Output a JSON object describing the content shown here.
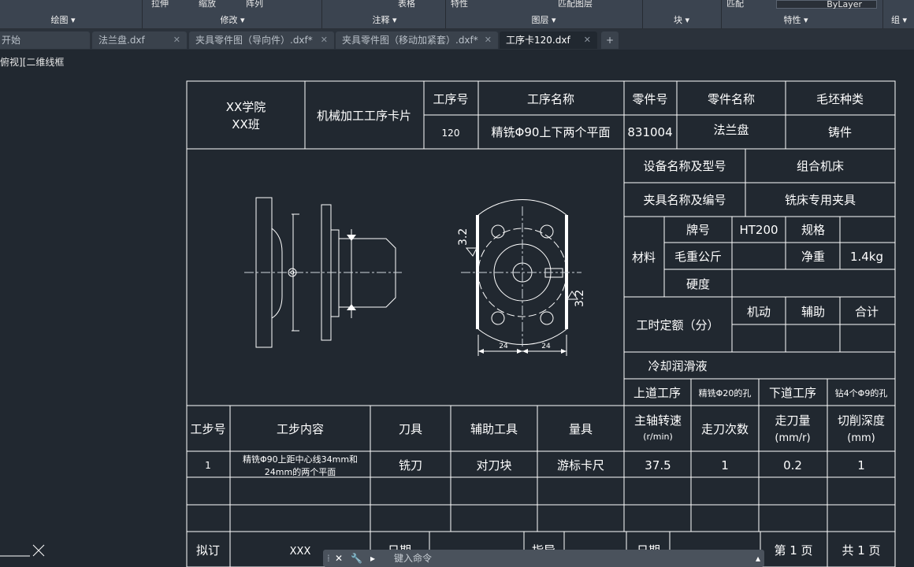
{
  "ribbon": {
    "tools": [
      "拉伸",
      "缩放",
      "阵列",
      "表格",
      "特性",
      "匹配图层",
      "匹配",
      "ByLayer"
    ],
    "panels": [
      "绘图 ▾",
      "修改 ▾",
      "注释 ▾",
      "图层 ▾",
      "块 ▾",
      "特性 ▾",
      "组 ▾"
    ]
  },
  "tabs": [
    {
      "label": "开始",
      "active": false
    },
    {
      "label": "法兰盘.dxf",
      "active": false
    },
    {
      "label": "夹具零件图（导向件）.dxf*",
      "active": false
    },
    {
      "label": "夹具零件图（移动加紧套）.dxf*",
      "active": false
    },
    {
      "label": "工序卡120.dxf",
      "active": true
    }
  ],
  "viewport_label": "俯视][二维线框",
  "header": {
    "school": "XX学院",
    "class_name": "XX班",
    "card_title": "机械加工工序卡片",
    "op_no_label": "工序号",
    "op_no": "120",
    "op_name_label": "工序名称",
    "op_name": "精铣Φ90上下两个平面",
    "part_no_label": "零件号",
    "part_no": "831004",
    "part_name_label": "零件名称",
    "part_name": "法兰盘",
    "blank_label": "毛坯种类",
    "blank": "铸件"
  },
  "info": {
    "equip_label": "设备名称及型号",
    "equip": "组合机床",
    "fixture_label": "夹具名称及编号",
    "fixture": "铣床专用夹具",
    "material_label": "材料",
    "grade_label": "牌号",
    "grade": "HT200",
    "spec_label": "规格",
    "gross_label": "毛重公斤",
    "net_label": "净重",
    "net": "1.4kg",
    "hardness_label": "硬度",
    "time_label": "工时定额（分）",
    "machine_label": "机动",
    "aux_label": "辅助",
    "total_label": "合计",
    "coolant_label": "冷却润滑液",
    "prev_label": "上道工序",
    "prev": "精铣Φ20的孔",
    "next_label": "下道工序",
    "next": "钻4个Φ9的孔"
  },
  "drawing": {
    "roughness_left": "3.2",
    "roughness_right": "3.2",
    "dim_left": "24",
    "dim_right": "24"
  },
  "steps": {
    "headers": [
      "工步号",
      "工步内容",
      "刀具",
      "辅助工具",
      "量具",
      "主轴转速",
      "(r/min)",
      "走刀次数",
      "走刀量",
      "(mm/r)",
      "切削深度",
      "(mm)"
    ],
    "row1": {
      "no": "1",
      "content_1": "精铣Φ90上距中心线34mm和",
      "content_2": "24mm的两个平面",
      "tool": "铣刀",
      "aux": "对刀块",
      "gauge": "游标卡尺",
      "speed": "37.5",
      "passes": "1",
      "feed": "0.2",
      "depth": "1"
    }
  },
  "footer": {
    "draft_label": "拟订",
    "drafter": "XXX",
    "date_label": "日期",
    "guide_label": "指导",
    "date2_label": "日期",
    "page_label": "第 1 页",
    "total_label": "共 1 页"
  },
  "command": {
    "placeholder": "键入命令"
  }
}
